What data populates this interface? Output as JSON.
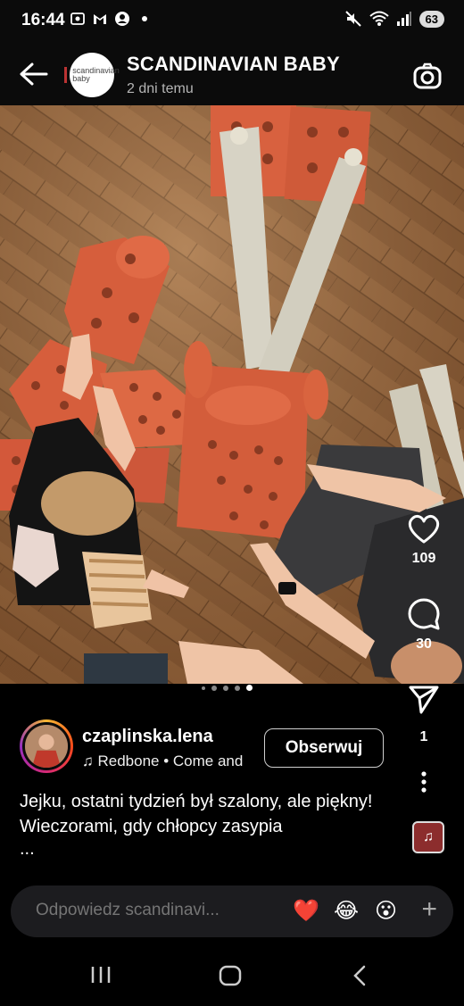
{
  "status_bar": {
    "time": "16:44",
    "battery": "63"
  },
  "header": {
    "title": "SCANDINAVIAN BABY",
    "subtitle": "2 dni temu",
    "logo_text_line1": "scandinavian",
    "logo_text_line2": "baby"
  },
  "actions": {
    "likes": "109",
    "comments": "30",
    "shares": "1"
  },
  "carousel": {
    "total": 5,
    "active": 4
  },
  "author": {
    "username": "czaplinska.lena",
    "music": "Redbone • Come and",
    "follow_label": "Obserwuj"
  },
  "caption": {
    "text": "Jejku, ostatni tydzień był szalony, ale piękny! Wieczorami, gdy chłopcy zasypia",
    "more": "..."
  },
  "reply": {
    "placeholder": "Odpowiedz scandinavi...",
    "emojis": [
      "❤️",
      "😂",
      "😮"
    ]
  },
  "colors": {
    "foam_orange": "#d8613f",
    "floor_wood": "#8a5a32",
    "background": "#0b0b0b"
  },
  "icons": [
    "back-arrow-icon",
    "camera-icon",
    "heart-icon",
    "comment-icon",
    "send-icon",
    "more-icon",
    "music-note-icon",
    "recents-icon",
    "home-icon",
    "back-nav-icon"
  ]
}
